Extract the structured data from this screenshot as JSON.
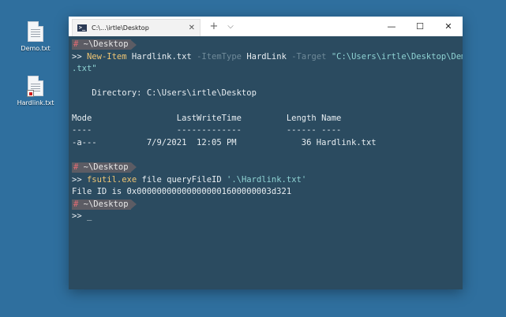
{
  "desktop": {
    "icons": [
      {
        "label": "Demo.txt",
        "icon": "text-file-icon",
        "shortcut": false
      },
      {
        "label": "Hardlink.txt",
        "icon": "text-file-shortcut-icon",
        "shortcut": true
      }
    ]
  },
  "window": {
    "tab_title": "C:\\...\\irtle\\Desktop",
    "tab_close_icon": "close-icon",
    "new_tab_label": "+",
    "dropdown_label": "⌵",
    "minimize_label": "—",
    "maximize_label": "☐",
    "close_label": "✕"
  },
  "terminal": {
    "prompt_hash": "#",
    "prompt_path": "~\\Desktop",
    "prompt_char": ">>",
    "cmd1": {
      "name": "New-Item",
      "arg1": "Hardlink.txt",
      "param1": "-ItemType",
      "value1": "HardLink",
      "param2": "-Target",
      "target_line1": "\"C:\\Users\\irtle\\Desktop\\Demo",
      "target_line2": ".txt\""
    },
    "directory_line": "    Directory: C:\\Users\\irtle\\Desktop",
    "table_header": "Mode                 LastWriteTime         Length Name",
    "table_rule": "----                 -------------         ------ ----",
    "table_row": "-a---          7/9/2021  12:05 PM             36 Hardlink.txt",
    "cmd2": {
      "name": "fsutil.exe",
      "args": "file queryFileID",
      "path": "'.\\Hardlink.txt'"
    },
    "output2": "File ID is 0x000000000000000001600000003d321",
    "cursor": "_"
  }
}
